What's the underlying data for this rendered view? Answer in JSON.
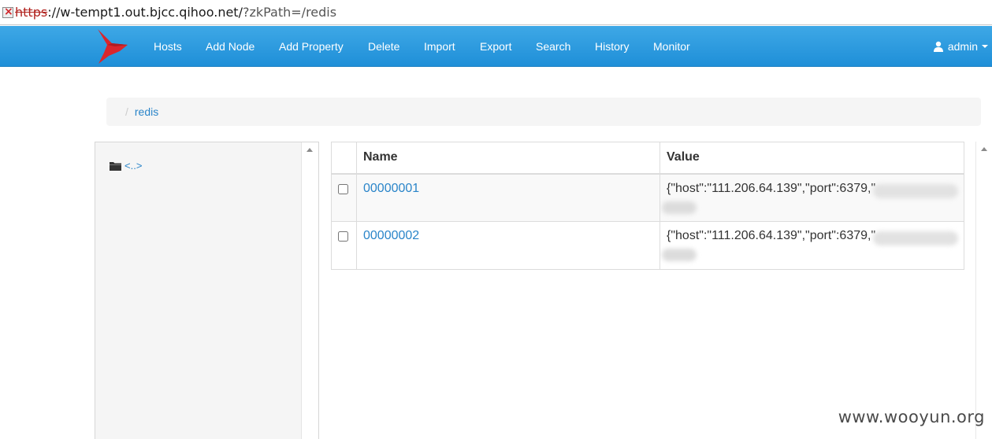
{
  "browser": {
    "url_scheme": "https",
    "url_host": "://w-tempt1.out.bjcc.qihoo.net/",
    "url_query": "?zkPath=/redis"
  },
  "nav": {
    "items": [
      {
        "label": "Hosts"
      },
      {
        "label": "Add Node"
      },
      {
        "label": "Add Property"
      },
      {
        "label": "Delete"
      },
      {
        "label": "Import"
      },
      {
        "label": "Export"
      },
      {
        "label": "Search"
      },
      {
        "label": "History"
      },
      {
        "label": "Monitor"
      }
    ],
    "user": "admin"
  },
  "breadcrumb": {
    "separator": "/",
    "current": "redis"
  },
  "tree": {
    "parent_label": "<..>"
  },
  "table": {
    "headers": {
      "name": "Name",
      "value": "Value"
    },
    "rows": [
      {
        "name": "00000001",
        "value": "{\"host\":\"111.206.64.139\",\"port\":6379,\""
      },
      {
        "name": "00000002",
        "value": "{\"host\":\"111.206.64.139\",\"port\":6379,\""
      }
    ]
  },
  "watermark": "www.wooyun.org",
  "colors": {
    "nav_background": "#2a9be0",
    "link": "#2a85c9",
    "logo_red": "#d9262c"
  }
}
